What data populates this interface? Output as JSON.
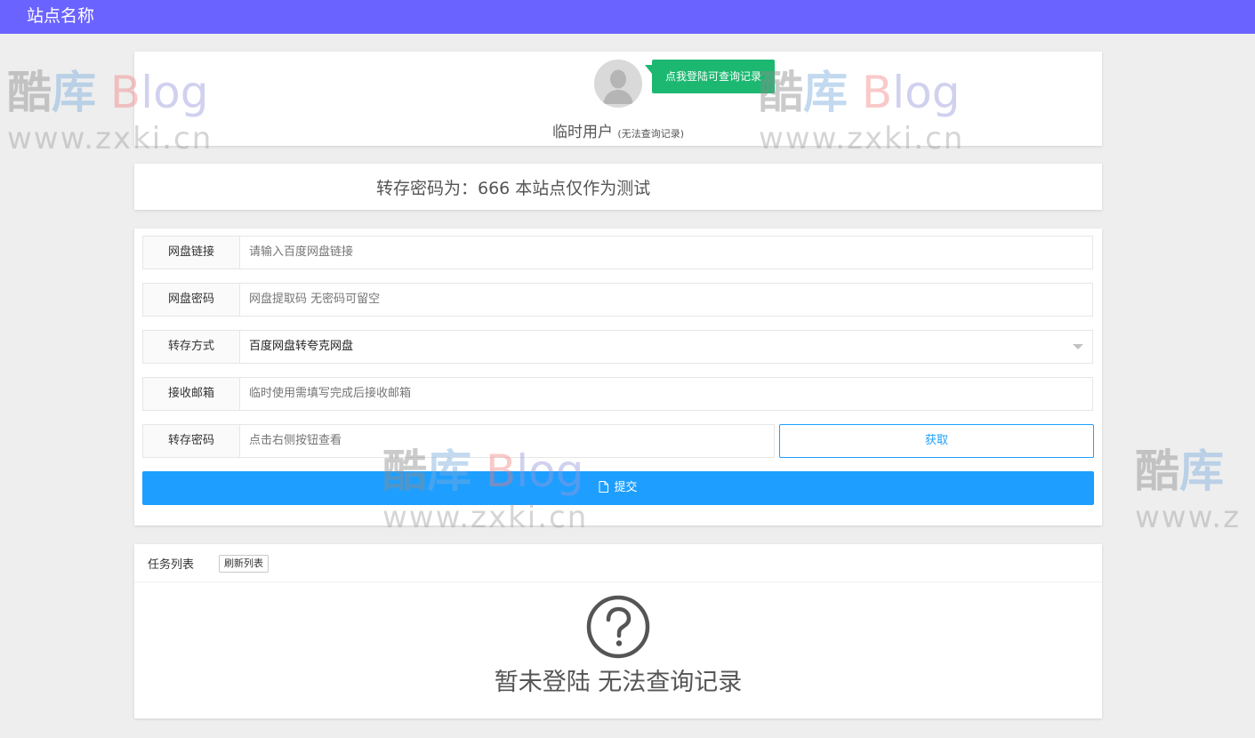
{
  "header": {
    "site_name": "站点名称"
  },
  "colors": {
    "header_bg": "#6b63ff",
    "tip_bg": "#1cb871",
    "primary": "#1e9fff"
  },
  "user": {
    "tip": "点我登陆可查询记录",
    "name": "临时用户",
    "status": "(无法查询记录)"
  },
  "notice": {
    "text": "转存密码为：666 本站点仅作为测试"
  },
  "form": {
    "fields": [
      {
        "label": "网盘链接",
        "placeholder": "请输入百度网盘链接"
      },
      {
        "label": "网盘密码",
        "placeholder": "网盘提取码 无密码可留空"
      },
      {
        "label": "转存方式",
        "value": "百度网盘转夸克网盘"
      },
      {
        "label": "接收邮箱",
        "placeholder": "临时使用需填写完成后接收邮箱"
      },
      {
        "label": "转存密码",
        "placeholder": "点击右侧按钮查看"
      }
    ],
    "get_button": "获取",
    "submit_button": "提交"
  },
  "tasks": {
    "title": "任务列表",
    "refresh_button": "刷新列表",
    "empty_message": "暂未登陆 无法查询记录"
  },
  "watermark": {
    "brand_cn": "酷库",
    "brand_en": "Blog",
    "url": "www.zxki.cn"
  }
}
